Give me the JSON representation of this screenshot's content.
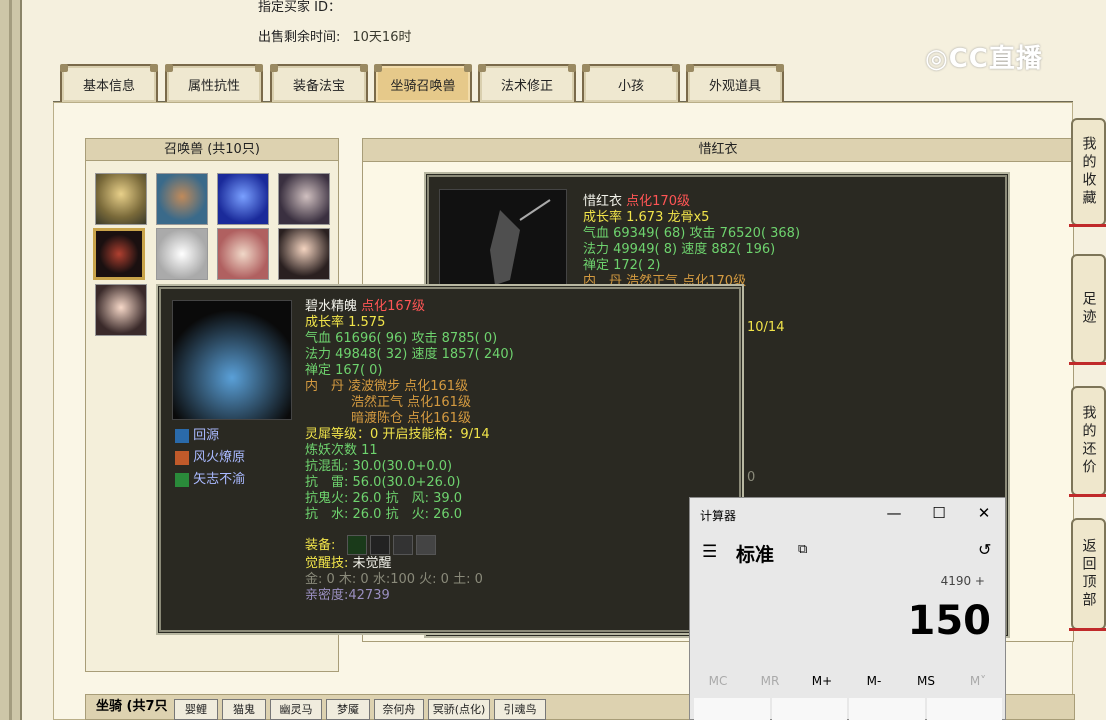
{
  "header": {
    "seller_label": "指定买家 ID：",
    "time_label": "出售剩余时间:",
    "time_value": "10天16时"
  },
  "tabs": [
    "基本信息",
    "属性抗性",
    "装备法宝",
    "坐骑召唤兽",
    "法术修正",
    "小孩",
    "外观道具"
  ],
  "active_tab": "坐骑召唤兽",
  "summons": {
    "title": "召唤兽 (共10只)"
  },
  "selected_name": "惜红衣",
  "main_tip": {
    "name": "惜红衣",
    "level": "点化170级",
    "growth": "成长率 1.673 龙骨x5",
    "hp": "气血 69349( 68)",
    "atk": "攻击 76520( 368)",
    "mp": "法力 49949( 8)",
    "spd": "速度 882( 196)",
    "zen": "禅定 172( 2)",
    "inner": "内　丹 浩然正气 点化170级",
    "extra": "10/14",
    "extra2": "0"
  },
  "hover_tip": {
    "name": "碧水精魄",
    "level": "点化167级",
    "growth": "成长率 1.575",
    "hp": "气血 61696( 96)",
    "atk": "攻击 8785( 0)",
    "mp": "法力 49848( 32)",
    "spd": "速度 1857( 240)",
    "zen": "禅定 167( 0)",
    "inner1": "内　丹 凌波微步 点化161级",
    "inner2": "浩然正气 点化161级",
    "inner3": "暗渡陈仓 点化161级",
    "ling": "灵犀等级：0 开启技能格：9/14",
    "yao": "炼妖次数 11",
    "res1": "抗混乱: 30.0(30.0+0.0)",
    "res2": "抗　雷: 56.0(30.0+26.0)",
    "res3": "抗鬼火: 26.0 抗　风: 39.0",
    "res4": "抗　水: 26.0 抗　火: 26.0",
    "equip": "装备:",
    "awaken_label": "觉醒技:",
    "awaken_value": "未觉醒",
    "elements": "金: 0 木: 0 水:100 火: 0 土: 0",
    "intimacy": "亲密度:42739",
    "skills": [
      "回源",
      "风火燎原",
      "矢志不渝"
    ]
  },
  "side_buttons": [
    "我的收藏",
    "足迹",
    "我的还价",
    "返回顶部"
  ],
  "calculator": {
    "title": "计算器",
    "mode": "标准",
    "expression": "4190 +",
    "display": "150",
    "memory": [
      "MC",
      "MR",
      "M+",
      "M-",
      "MS",
      "M˅"
    ]
  },
  "mount_bar": {
    "label": "坐骑 (共7只",
    "tabs": [
      "婴鲤",
      "猫鬼",
      "幽灵马",
      "梦魇",
      "奈何舟",
      "冥骄(点化)",
      "引魂鸟"
    ]
  },
  "watermark": "CC直播",
  "colors": {
    "bg": "#f5f0de",
    "tip_bg": "#2a2922",
    "active_tab": "#e6c98a"
  }
}
